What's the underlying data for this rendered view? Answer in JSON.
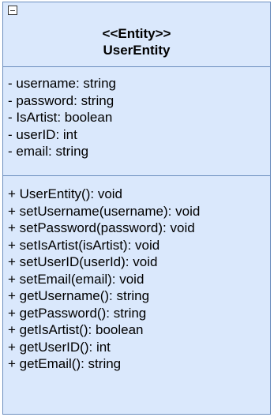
{
  "class": {
    "stereotype": "<<Entity>>",
    "name": "UserEntity",
    "attributes": [
      "- username: string",
      "- password: string",
      "- IsArtist: boolean",
      "- userID: int",
      "- email: string"
    ],
    "methods": [
      "+ UserEntity(): void",
      "+ setUsername(username): void",
      "+ setPassword(password): void",
      "+ setIsArtist(isArtist): void",
      "+ setUserID(userId): void",
      "+ setEmail(email): void",
      "+ getUsername(): string",
      "+ getPassword(): string",
      "+ getIsArtist(): boolean",
      "+ getUserID(): int",
      "+ getEmail(): string"
    ]
  },
  "colors": {
    "fill": "#dae8fc",
    "stroke": "#6c8ebf"
  },
  "icons": {
    "collapse": "collapse-icon"
  }
}
